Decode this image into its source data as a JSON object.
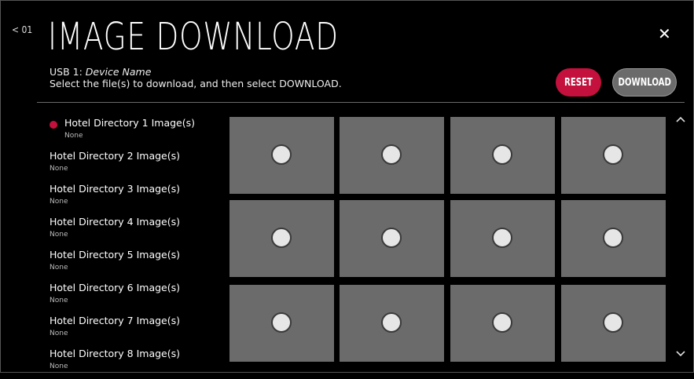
{
  "header": {
    "back_label": "< 01",
    "title": "IMAGE DOWNLOAD",
    "close_glyph": "✕",
    "usb_prefix": "USB 1:",
    "device_name": "Device Name",
    "instruction": "Select the file(s) to download, and then select DOWNLOAD."
  },
  "buttons": {
    "reset": "RESET",
    "download": "DOWNLOAD"
  },
  "colors": {
    "accent": "#c3103c",
    "tile": "#6b6b6b",
    "background": "#000000"
  },
  "list": [
    {
      "name": "Hotel Directory 1 Image(s)",
      "state": "None",
      "selected": true
    },
    {
      "name": "Hotel Directory 2 Image(s)",
      "state": "None",
      "selected": false
    },
    {
      "name": "Hotel Directory 3 Image(s)",
      "state": "None",
      "selected": false
    },
    {
      "name": "Hotel Directory 4 Image(s)",
      "state": "None",
      "selected": false
    },
    {
      "name": "Hotel Directory 5 Image(s)",
      "state": "None",
      "selected": false
    },
    {
      "name": "Hotel Directory 6 Image(s)",
      "state": "None",
      "selected": false
    },
    {
      "name": "Hotel Directory 7 Image(s)",
      "state": "None",
      "selected": false
    },
    {
      "name": "Hotel Directory 8 Image(s)",
      "state": "None",
      "selected": false
    }
  ],
  "grid": {
    "rows": 3,
    "columns": 4,
    "tile_icon": "radio-unchecked-icon"
  },
  "scroll": {
    "up_icon": "chevron-up-icon",
    "down_icon": "chevron-down-icon"
  }
}
